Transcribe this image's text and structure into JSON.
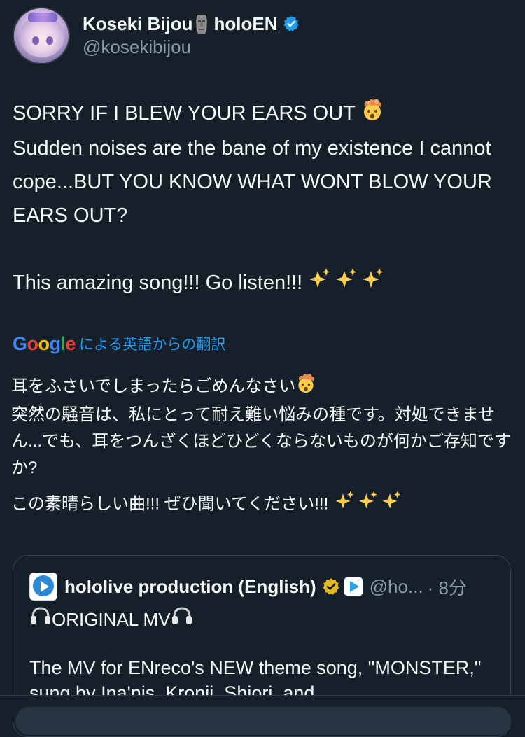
{
  "author": {
    "display_name": "Koseki Bijou",
    "name_suffix": "holoEN",
    "handle": "@kosekibijou"
  },
  "tweet": {
    "line1": "SORRY IF I BLEW YOUR EARS OUT ",
    "line2": "Sudden noises are the bane of my existence I cannot cope...BUT YOU KNOW WHAT WONT BLOW YOUR EARS OUT?",
    "line3": "This amazing song!!! Go listen!!! "
  },
  "translation": {
    "provider": "Google",
    "label": "による英語からの翻訳",
    "para1_line1": "耳をふさいでしまったらごめんなさい",
    "para1_rest": "突然の騒音は、私にとって耐え難い悩みの種です。対処できません...でも、耳をつんざくほどひどくならないものが何かご存知ですか?",
    "para2": "この素晴らしい曲!!! ぜひ聞いてください!!! "
  },
  "quote": {
    "name": "hololive production (English)",
    "handle": "@ho...",
    "time": "· 8分",
    "title": "ORIGINAL MV",
    "body": "The MV for ENreco's NEW theme song, \"MONSTER,\" sung by Ina'nis, Kronii, Shiori, and"
  },
  "icons": {
    "moai": "moai-emoji",
    "verified": "verified-badge-icon",
    "exploding_head": "exploding-head-emoji",
    "sparkles": "sparkles-emoji",
    "headphones": "headphones-emoji"
  },
  "colors": {
    "background": "#15202b",
    "link": "#1d9bf0",
    "muted": "#8b98a5",
    "border": "#38444d"
  }
}
